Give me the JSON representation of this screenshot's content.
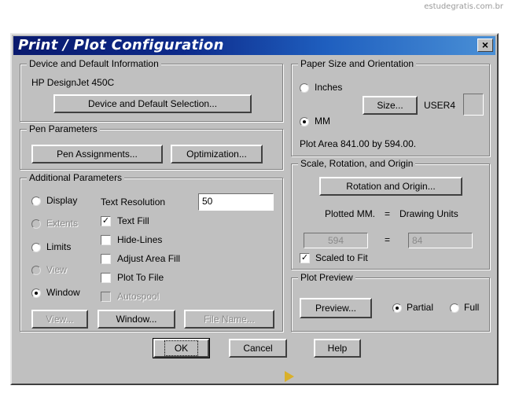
{
  "watermark": "estudegratis.com.br",
  "window": {
    "title": "Print / Plot Configuration",
    "close_glyph": "×"
  },
  "device": {
    "legend": "Device and Default Information",
    "name": "HP DesignJet 450C",
    "select_button": "Device and Default Selection..."
  },
  "pen": {
    "legend": "Pen Parameters",
    "assignments_button": "Pen Assignments...",
    "optimization_button": "Optimization..."
  },
  "additional": {
    "legend": "Additional Parameters",
    "radios": [
      {
        "label": "Display",
        "selected": false,
        "enabled": true
      },
      {
        "label": "Extents",
        "selected": false,
        "enabled": false
      },
      {
        "label": "Limits",
        "selected": false,
        "enabled": true
      },
      {
        "label": "View",
        "selected": false,
        "enabled": false
      },
      {
        "label": "Window",
        "selected": true,
        "enabled": true
      }
    ],
    "text_resolution_label": "Text Resolution",
    "text_resolution_value": "50",
    "checks": [
      {
        "label": "Text Fill",
        "checked": true,
        "enabled": true
      },
      {
        "label": "Hide-Lines",
        "checked": false,
        "enabled": true
      },
      {
        "label": "Adjust Area Fill",
        "checked": false,
        "enabled": true
      },
      {
        "label": "Plot To File",
        "checked": false,
        "enabled": true
      },
      {
        "label": "Autospool",
        "checked": false,
        "enabled": false
      }
    ],
    "view_button": "View...",
    "window_button": "Window...",
    "filename_button": "File Name..."
  },
  "paper": {
    "legend": "Paper Size and Orientation",
    "inches_label": "Inches",
    "mm_label": "MM",
    "units_selected": "MM",
    "size_button": "Size...",
    "size_name": "USER4",
    "plot_area": "Plot Area 841.00 by 594.00."
  },
  "scale": {
    "legend": "Scale, Rotation, and Origin",
    "rotation_button": "Rotation and Origin...",
    "plotted_label": "Plotted MM.",
    "equals": "=",
    "drawing_units_label": "Drawing Units",
    "plotted_value": "594",
    "drawing_value": "84",
    "scaled_to_fit_label": "Scaled to Fit",
    "scaled_to_fit": true
  },
  "preview": {
    "legend": "Plot Preview",
    "preview_button": "Preview...",
    "partial_label": "Partial",
    "full_label": "Full",
    "selected": "Partial"
  },
  "footer": {
    "ok": "OK",
    "cancel": "Cancel",
    "help": "Help"
  }
}
